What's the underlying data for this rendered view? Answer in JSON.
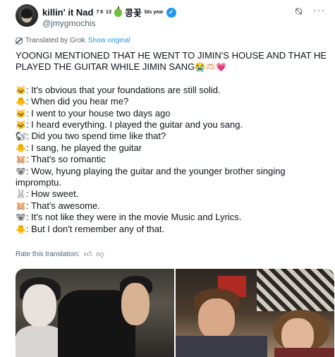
{
  "author": {
    "display_name": "killin' it Nad",
    "sup_digits": "7 6",
    "sub_digits": "13",
    "name_extra": "콩꽃",
    "badge_text": "bts year",
    "handle": "@jmygmochis"
  },
  "icons": {
    "grok": "grok-icon",
    "more": "more-icon",
    "verified": "verified-badge-icon",
    "thumbs_up": "thumbs-up-icon",
    "thumbs_down": "thumbs-down-icon"
  },
  "translation": {
    "label": "Translated by Grok",
    "show_original": "Show original",
    "rate_label": "Rate this translation:"
  },
  "tweet": {
    "headline": "YOONGI MENTIONED THAT HE WENT TO JIMIN'S HOUSE AND THAT HE PLAYED THE GUITAR WHILE JIMIN SANG",
    "headline_emojis": "😭🫶🏻💗",
    "lines": [
      {
        "emoji": "🐱",
        "text": ": It's obvious that your foundations are still solid."
      },
      {
        "emoji": "🐥",
        "text": ": When did you hear me?"
      },
      {
        "emoji": "🐱",
        "text": ": I went to your house two days ago"
      },
      {
        "emoji": "🐱",
        "text": ": I heard everything. I played the guitar and you sang."
      },
      {
        "emoji": "🐿",
        "text": ": Did you two spend time like that?"
      },
      {
        "emoji": "🐥",
        "text": ": I sang, he played the guitar"
      },
      {
        "emoji": "🐹",
        "text": ": That's so romantic"
      },
      {
        "emoji": "🐨",
        "text": ": Wow, hyung playing the guitar and the younger brother singing impromptu."
      },
      {
        "emoji": "🐰",
        "text": ": How sweet."
      },
      {
        "emoji": "🐹",
        "text": ": That's awesome."
      },
      {
        "emoji": "🐨",
        "text": ": It's not like they were in the movie Music and Lyrics."
      },
      {
        "emoji": "🐥",
        "text": ": But I don't remember any of that."
      }
    ]
  },
  "colors": {
    "link": "#1d9bf0",
    "muted": "#536471",
    "text": "#0f1419"
  }
}
